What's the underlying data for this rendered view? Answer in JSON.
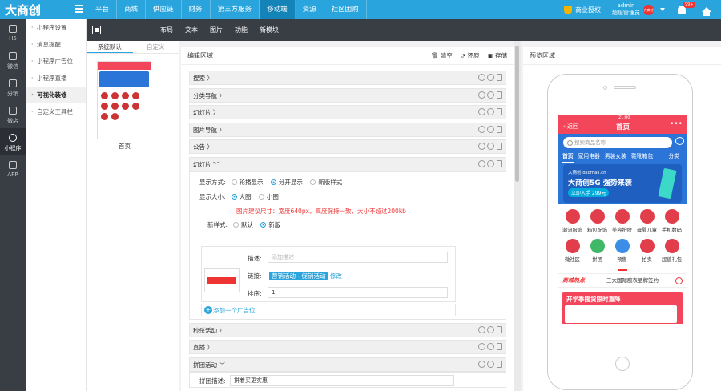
{
  "app": {
    "logo": "大商创"
  },
  "top_nav": [
    "平台",
    "商城",
    "供应链",
    "财务",
    "第三方服务",
    "移动端",
    "资源",
    "社区团购"
  ],
  "top_nav_active": 5,
  "top_right": {
    "auth_label": "商业授权",
    "user_name": "admin",
    "user_role": "超级管理员",
    "avatar_text": "大商创",
    "notification_count": "99+"
  },
  "left_nav": [
    {
      "label": "H5",
      "icon": "h5-icon"
    },
    {
      "label": "微信",
      "icon": "wechat-icon"
    },
    {
      "label": "分销",
      "icon": "distribution-icon"
    },
    {
      "label": "微店",
      "icon": "shop-icon"
    },
    {
      "label": "小程序",
      "icon": "compass-icon"
    },
    {
      "label": "APP",
      "icon": "app-icon"
    }
  ],
  "left_nav_active": 4,
  "sub_menu": [
    "小程序设置",
    "消息提醒",
    "小程序广告位",
    "小程序直播",
    "可视化装修",
    "自定义工具栏"
  ],
  "sub_menu_active": 4,
  "toolbar": {
    "items": [
      "布局",
      "文本",
      "图片",
      "功能",
      "新模块"
    ]
  },
  "templates": {
    "tabs": [
      "系统默认",
      "自定义"
    ],
    "active_tab": 0,
    "thumb_label": "首页"
  },
  "editor": {
    "title": "编辑区域",
    "actions": {
      "clear": "清空",
      "restore": "还原",
      "save": "存储"
    },
    "rows_before": [
      "搜索",
      "分类导航",
      "幻灯片",
      "图片导航",
      "公告"
    ],
    "expanded": {
      "title": "幻灯片",
      "display_mode_label": "显示方式:",
      "display_modes": [
        "轮播显示",
        "分开显示",
        "新版样式"
      ],
      "display_mode_selected": 1,
      "size_label": "显示大小:",
      "sizes": [
        "大图",
        "小图"
      ],
      "size_selected": 0,
      "hint": "图片建议尺寸：宽度640px，高度保持一致，大小不超过200kb",
      "style_label": "新样式:",
      "styles": [
        "默认",
        "新版"
      ],
      "style_selected": 1,
      "desc_label": "描述:",
      "desc_placeholder": "添加描述",
      "link_label": "链接:",
      "link_tag": "营销活动 - 促销活动",
      "link_edit": "修改",
      "order_label": "排序:",
      "order_value": "1",
      "add_label": "添加一个广告位"
    },
    "rows_after": [
      "秒杀活动",
      "直播"
    ],
    "partial_row": "拼团活动",
    "partial_field_label": "拼团描述:",
    "partial_field_value": "拼着买更实惠"
  },
  "preview": {
    "title": "预览区域",
    "time": "21:00",
    "back": "返回",
    "page_title": "首页",
    "search_placeholder": "搜索商品名称",
    "categories": [
      "首页",
      "家用电器",
      "男装女装",
      "鞋靴箱包"
    ],
    "cat_more": "分类",
    "banner": {
      "small": "大商创 dscmall.cn",
      "main": "大商创5G 强势来袭",
      "btn": "立即入手 299元"
    },
    "grid": [
      "潮流服饰",
      "箱包配饰",
      "美容护肤",
      "母婴儿童",
      "手机数码",
      "微社区",
      "拼团",
      "预售",
      "拍卖",
      "超值礼包"
    ],
    "news_tag": "商城热点",
    "news_text": "三大国际腕表品牌签约",
    "promo_title": "开学季囤货限时直降"
  }
}
